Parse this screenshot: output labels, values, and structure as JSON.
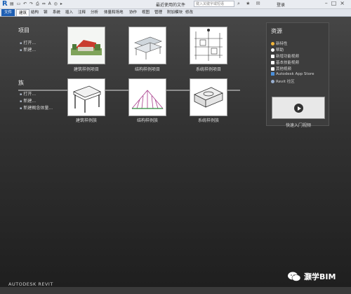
{
  "titlebar": {
    "app_logo": "R",
    "doc_title": "最近使用的文件",
    "search_placeholder": "键入关键字或短语",
    "login_label": "登录",
    "quick_access_icons": [
      "open-icon",
      "save-icon",
      "undo-icon",
      "redo-icon",
      "print-icon",
      "measure-icon",
      "text-icon"
    ],
    "window_icons": [
      "minimize-icon",
      "maximize-icon",
      "close-icon"
    ]
  },
  "ribbon": {
    "tabs": [
      "文件",
      "建筑",
      "结构",
      "钢",
      "系统",
      "插入",
      "注释",
      "分析",
      "体量和场地",
      "协作",
      "视图",
      "管理",
      "附加模块",
      "修改"
    ]
  },
  "projects": {
    "title": "项目",
    "links": [
      "打开...",
      "新建..."
    ],
    "thumbnails": [
      {
        "caption": "建筑样例项目"
      },
      {
        "caption": "结构样例项目"
      },
      {
        "caption": "系统样例项目"
      }
    ]
  },
  "families": {
    "title": "族",
    "links": [
      "打开...",
      "新建...",
      "新建概念体量..."
    ],
    "thumbnails": [
      {
        "caption": "建筑样例族"
      },
      {
        "caption": "结构样例族"
      },
      {
        "caption": "系统样例族"
      }
    ]
  },
  "resources": {
    "title": "资源",
    "items": [
      {
        "label": "新特性",
        "icon": "bulb-icon",
        "color": "#f3b53a"
      },
      {
        "label": "帮助",
        "icon": "help-icon",
        "color": "#ffffff"
      },
      {
        "label": "新增功能视频",
        "icon": "video-icon",
        "color": "#ffffff"
      },
      {
        "label": "基本技能视频",
        "icon": "video-icon",
        "color": "#ffffff"
      },
      {
        "label": "其他视频",
        "icon": "video-icon",
        "color": "#ffffff"
      },
      {
        "label": "Autodesk App Store",
        "icon": "store-icon",
        "color": "#4a8fd9"
      },
      {
        "label": "Revit 社区",
        "icon": "community-icon",
        "color": "#9ab0d0"
      }
    ],
    "video_caption": "快速入门视频"
  },
  "brand": "AUTODESK  REVIT",
  "watermark": "灏学BIM"
}
